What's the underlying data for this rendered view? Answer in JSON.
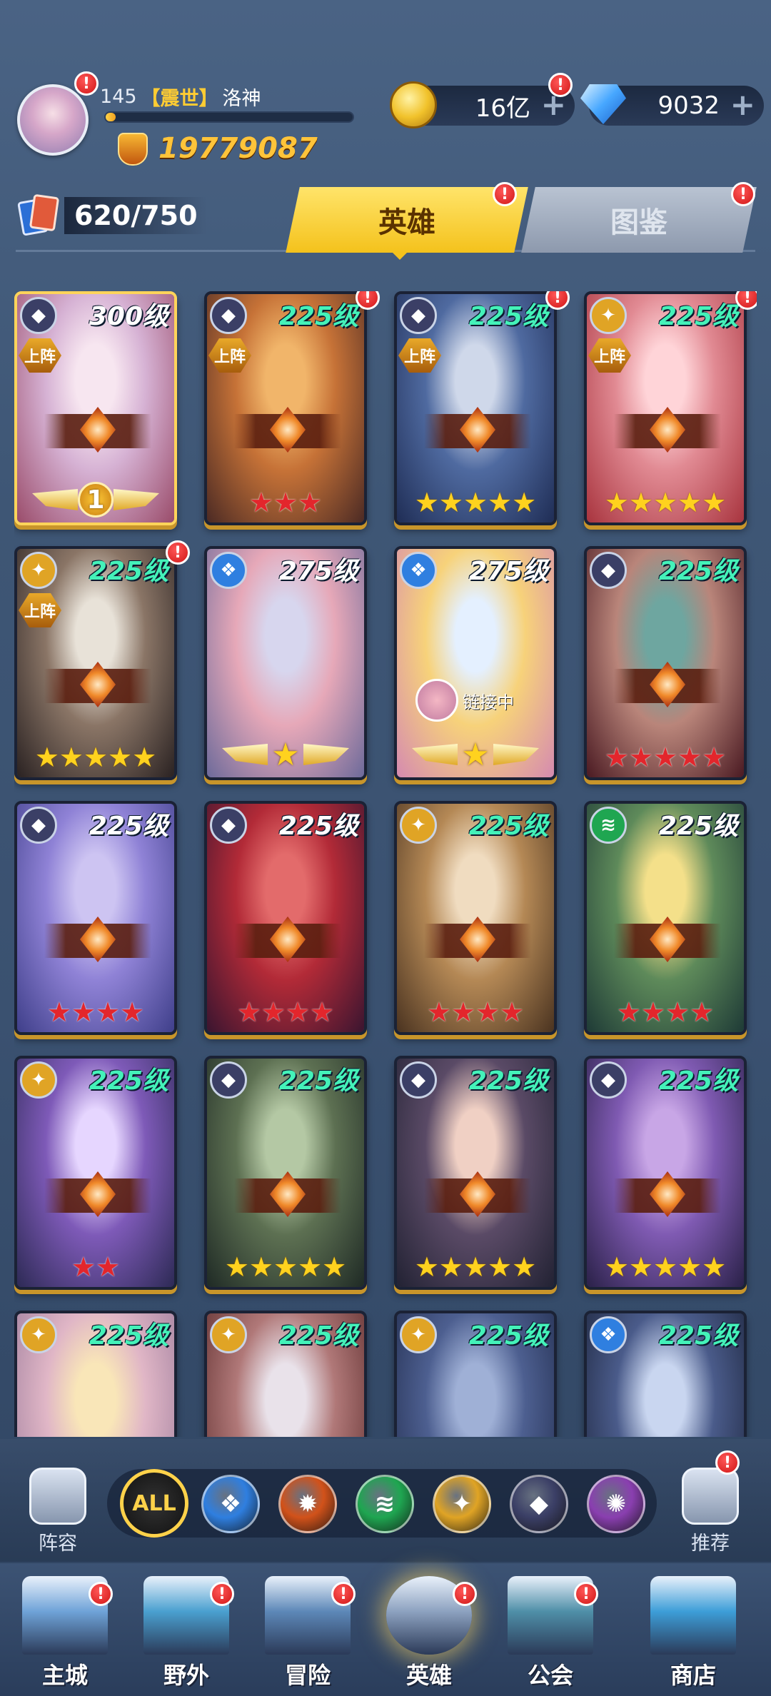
{
  "player": {
    "level": "145",
    "title": "【震世】",
    "name": "洛神",
    "power": "19779087",
    "xp_fraction": 0.04
  },
  "resources": {
    "gold": "16亿",
    "gems": "9032"
  },
  "hero_count": "620/750",
  "tabs": {
    "heroes": "英雄",
    "album": "图鉴"
  },
  "cards": [
    {
      "level": "300级",
      "lvl_color": "white",
      "element": "dark",
      "deployed": true,
      "stars_type": "wings-num",
      "wing_label": "1",
      "alert": false,
      "palette": [
        "#f7e6f0",
        "#d6b2d4",
        "#9a4c6a"
      ],
      "gold_frame": true
    },
    {
      "level": "225级",
      "lvl_color": "green",
      "element": "dark",
      "deployed": true,
      "stars_type": "red",
      "stars": 3,
      "alert": true,
      "palette": [
        "#f1b56a",
        "#c67237",
        "#4b2a24"
      ]
    },
    {
      "level": "225级",
      "lvl_color": "green",
      "element": "dark",
      "deployed": true,
      "stars_type": "yellow",
      "stars": 5,
      "alert": true,
      "palette": [
        "#cfd8ea",
        "#4f6aa0",
        "#1f2d55"
      ]
    },
    {
      "level": "225级",
      "lvl_color": "green",
      "element": "light",
      "deployed": true,
      "stars_type": "yellow",
      "stars": 5,
      "alert": true,
      "palette": [
        "#ffd4d8",
        "#e18a93",
        "#a8343e"
      ]
    },
    {
      "level": "225级",
      "lvl_color": "green",
      "element": "light",
      "deployed": true,
      "stars_type": "yellow",
      "stars": 5,
      "alert": true,
      "palette": [
        "#e8e2d8",
        "#8a7566",
        "#2a2222"
      ]
    },
    {
      "level": "275级",
      "lvl_color": "white",
      "element": "water",
      "deployed": false,
      "stars_type": "wings-star",
      "alert": false,
      "palette": [
        "#d7d6ee",
        "#e6a8b8",
        "#6d6a9a"
      ]
    },
    {
      "level": "275级",
      "lvl_color": "white",
      "element": "water",
      "deployed": false,
      "stars_type": "wings-star",
      "alert": false,
      "link_text": "链接中",
      "palette": [
        "#e4f0ff",
        "#f7d27a",
        "#d58ab0"
      ]
    },
    {
      "level": "225级",
      "lvl_color": "green",
      "element": "dark",
      "deployed": false,
      "stars_type": "red",
      "stars": 5,
      "alert": false,
      "palette": [
        "#6ea6a0",
        "#b9857a",
        "#4a1a22"
      ]
    },
    {
      "level": "225级",
      "lvl_color": "white",
      "element": "dark",
      "deployed": false,
      "stars_type": "red",
      "stars": 4,
      "alert": false,
      "palette": [
        "#cdc4f2",
        "#8f82d6",
        "#3f3f8a"
      ]
    },
    {
      "level": "225级",
      "lvl_color": "white",
      "element": "dark",
      "deployed": false,
      "stars_type": "red",
      "stars": 4,
      "alert": false,
      "palette": [
        "#e36b6b",
        "#b22a37",
        "#3a1530"
      ]
    },
    {
      "level": "225级",
      "lvl_color": "green",
      "element": "light",
      "deployed": false,
      "stars_type": "red",
      "stars": 4,
      "alert": false,
      "palette": [
        "#f0dcc0",
        "#b48855",
        "#4a3320"
      ]
    },
    {
      "level": "225级",
      "lvl_color": "white",
      "element": "wind",
      "deployed": false,
      "stars_type": "red",
      "stars": 4,
      "alert": false,
      "palette": [
        "#f4e08a",
        "#5e8a5a",
        "#1e3a36"
      ]
    },
    {
      "level": "225级",
      "lvl_color": "green",
      "element": "light",
      "deployed": false,
      "stars_type": "red",
      "stars": 2,
      "alert": false,
      "palette": [
        "#e6d6ff",
        "#7e5ab8",
        "#2d2a55"
      ]
    },
    {
      "level": "225级",
      "lvl_color": "green",
      "element": "dark",
      "deployed": false,
      "stars_type": "yellow",
      "stars": 5,
      "alert": false,
      "palette": [
        "#b4c8a4",
        "#5d7052",
        "#1f2a25"
      ]
    },
    {
      "level": "225级",
      "lvl_color": "green",
      "element": "dark",
      "deployed": false,
      "stars_type": "yellow",
      "stars": 5,
      "alert": false,
      "palette": [
        "#f0d0c4",
        "#5a4a66",
        "#222233"
      ]
    },
    {
      "level": "225级",
      "lvl_color": "green",
      "element": "dark",
      "deployed": false,
      "stars_type": "yellow",
      "stars": 5,
      "alert": false,
      "palette": [
        "#c8a6e6",
        "#7f5ab2",
        "#2a2148"
      ]
    },
    {
      "level": "225级",
      "lvl_color": "green",
      "element": "light",
      "deployed": false,
      "stars_type": "none",
      "alert": false,
      "palette": [
        "#f9e6b8",
        "#e0b6c6",
        "#9a7a9a"
      ]
    },
    {
      "level": "225级",
      "lvl_color": "green",
      "element": "light",
      "deployed": false,
      "stars_type": "none",
      "alert": false,
      "palette": [
        "#e9e2ea",
        "#b07878",
        "#5a2a2a"
      ]
    },
    {
      "level": "225级",
      "lvl_color": "green",
      "element": "light",
      "deployed": false,
      "stars_type": "none",
      "alert": false,
      "palette": [
        "#9fb0d6",
        "#4d5f90",
        "#1f2a4a"
      ]
    },
    {
      "level": "225级",
      "lvl_color": "green",
      "element": "water",
      "deployed": false,
      "stars_type": "none",
      "alert": false,
      "palette": [
        "#c9d6f0",
        "#4a5b8a",
        "#1a2238"
      ]
    }
  ],
  "deploy_label": "上阵",
  "element_colors": {
    "dark": "#3b3f66",
    "light": "#e0a425",
    "water": "#2f7fe0",
    "wind": "#1fa651",
    "fire": "#d2521a",
    "arcane": "#8a3fb0"
  },
  "filters": {
    "left_label": "阵容",
    "right_label": "推荐",
    "all_label": "ALL",
    "orbs": [
      "water",
      "fire",
      "wind",
      "light",
      "dark",
      "arcane"
    ]
  },
  "nav": [
    {
      "label": "主城",
      "icon": "castle-icon",
      "alert": true,
      "color": "#6fa3d8"
    },
    {
      "label": "野外",
      "icon": "portal-icon",
      "alert": true,
      "color": "#4aa0d0"
    },
    {
      "label": "冒险",
      "icon": "sword-icon",
      "alert": true,
      "color": "#5d88b8"
    },
    {
      "label": "英雄",
      "icon": "knight-icon",
      "alert": true,
      "color": "#8da2c0",
      "active": true
    },
    {
      "label": "公会",
      "icon": "guild-icon",
      "alert": true,
      "color": "#4f8fa8"
    },
    {
      "label": "商店",
      "icon": "shop-icon",
      "alert": false,
      "color": "#3d9ed8"
    }
  ],
  "alert_glyph": "!"
}
